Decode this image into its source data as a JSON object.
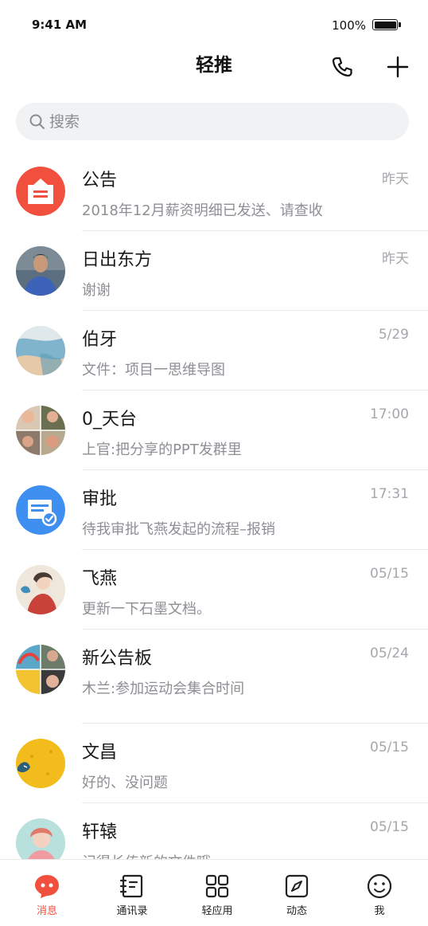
{
  "status_bar": {
    "time": "9:41 AM",
    "battery": "100%"
  },
  "header": {
    "title": "轻推",
    "phone_icon": "phone-icon",
    "add_icon": "plus-icon"
  },
  "search": {
    "placeholder": "搜索",
    "value": ""
  },
  "conversations": [
    {
      "name": "公告",
      "time": "昨天",
      "preview": "2018年12月薪资明细已发送、请查收",
      "avatar": "announcement-icon",
      "color": "#f0503d"
    },
    {
      "name": "日出东方",
      "time": "昨天",
      "preview": "谢谢",
      "avatar": "user-photo"
    },
    {
      "name": "伯牙",
      "time": "5/29",
      "preview": "文件：项目一思维导图",
      "avatar": "user-photo"
    },
    {
      "name": "0_天台",
      "time": "17:00",
      "preview": "上官:把分享的PPT发群里",
      "avatar": "group-photo"
    },
    {
      "name": "审批",
      "time": "17:31",
      "preview": "待我审批飞燕发起的流程–报销",
      "avatar": "approval-icon",
      "color": "#3f8ff0"
    },
    {
      "name": "飞燕",
      "time": "05/15",
      "preview": "更新一下石墨文档。",
      "avatar": "user-photo"
    },
    {
      "name": "新公告板",
      "time": "05/24",
      "preview": "木兰:参加运动会集合时间",
      "avatar": "group-photo"
    },
    {
      "name": "文昌",
      "time": "05/15",
      "preview": "好的、没问题",
      "avatar": "user-photo"
    },
    {
      "name": "轩辕",
      "time": "05/15",
      "preview": "记得长传新的文件哦",
      "avatar": "user-photo"
    }
  ],
  "tabs": [
    {
      "label": "消息",
      "icon": "chat-bubble-icon",
      "active": true
    },
    {
      "label": "通讯录",
      "icon": "contacts-icon",
      "active": false
    },
    {
      "label": "轻应用",
      "icon": "apps-grid-icon",
      "active": false
    },
    {
      "label": "动态",
      "icon": "compass-icon",
      "active": false
    },
    {
      "label": "我",
      "icon": "smiley-icon",
      "active": false
    }
  ],
  "colors": {
    "accent": "#f0503d",
    "blue": "#3f8ff0",
    "muted": "#8d8f94"
  }
}
